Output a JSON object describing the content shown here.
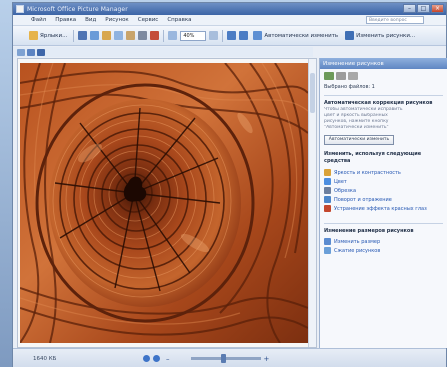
{
  "window": {
    "title": "Microsoft Office Picture Manager"
  },
  "menu": [
    "Файл",
    "Правка",
    "Вид",
    "Рисунок",
    "Сервис",
    "Справка"
  ],
  "help_box": {
    "placeholder": "Введите вопрос"
  },
  "toolbar": {
    "shortcuts_label": "Ярлыки...",
    "zoom_value": "40%",
    "auto_correct_label": "Автоматически изменить",
    "edit_pictures_label": "Изменить рисунки..."
  },
  "status": {
    "size_text": "1640 КБ"
  },
  "taskpane": {
    "title": "Изменение рисунков",
    "selected_text": "Выбрано файлов: 1",
    "auto_section_title": "Автоматическая коррекция рисунков",
    "auto_desc": [
      "Чтобы автоматически исправить",
      "цвет и яркость выбранных",
      "рисунков, нажмите кнопку",
      "\"Автоматически изменить\""
    ],
    "auto_button": "Автоматически изменить",
    "tools_section_title": "Изменить, используя следующие средства",
    "tools": [
      {
        "label": "Яркость и контрастность",
        "icon": "brightness-icon",
        "color": "#d9a23a"
      },
      {
        "label": "Цвет",
        "icon": "color-icon",
        "color": "#4d8ee0"
      },
      {
        "label": "Обрезка",
        "icon": "crop-icon",
        "color": "#6c7f9e"
      },
      {
        "label": "Поворот и отражение",
        "icon": "rotate-icon",
        "color": "#4c86c9"
      },
      {
        "label": "Устранение эффекта красных глаз",
        "icon": "redeye-icon",
        "color": "#c4472d"
      }
    ],
    "size_section_title": "Изменение размеров рисунков",
    "size_tools": [
      {
        "label": "Изменить размер",
        "icon": "resize-icon",
        "color": "#5a8bd0"
      },
      {
        "label": "Сжатие рисунков",
        "icon": "compress-icon",
        "color": "#6a9fd8"
      }
    ]
  }
}
